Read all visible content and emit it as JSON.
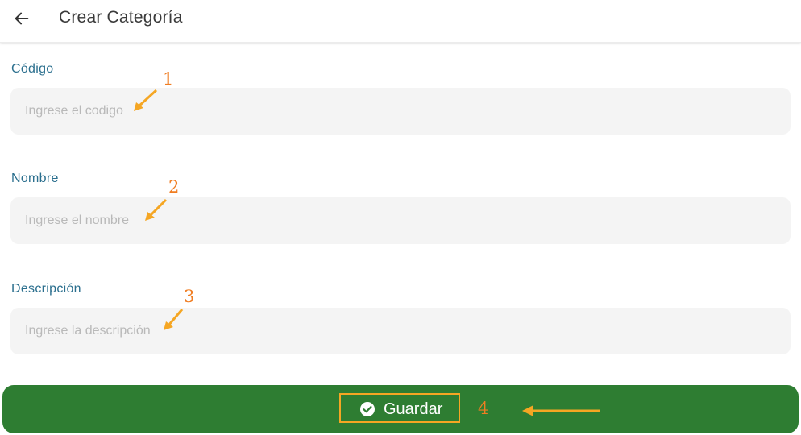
{
  "header": {
    "title": "Crear Categoría",
    "back_icon": "arrow-left-icon"
  },
  "form": {
    "fields": [
      {
        "label": "Código",
        "placeholder": "Ingrese el codigo",
        "value": ""
      },
      {
        "label": "Nombre",
        "placeholder": "Ingrese el nombre",
        "value": ""
      },
      {
        "label": "Descripción",
        "placeholder": "Ingrese la descripción",
        "value": ""
      }
    ],
    "save_button": {
      "label": "Guardar",
      "icon": "check-circle-icon"
    }
  },
  "annotations": [
    "1",
    "2",
    "3",
    "4"
  ],
  "colors": {
    "label": "#2b6f8e",
    "input_bg": "#f4f4f4",
    "button_bg": "#2e7d32",
    "annotation": "#f07d22",
    "highlight": "#f5a623"
  }
}
